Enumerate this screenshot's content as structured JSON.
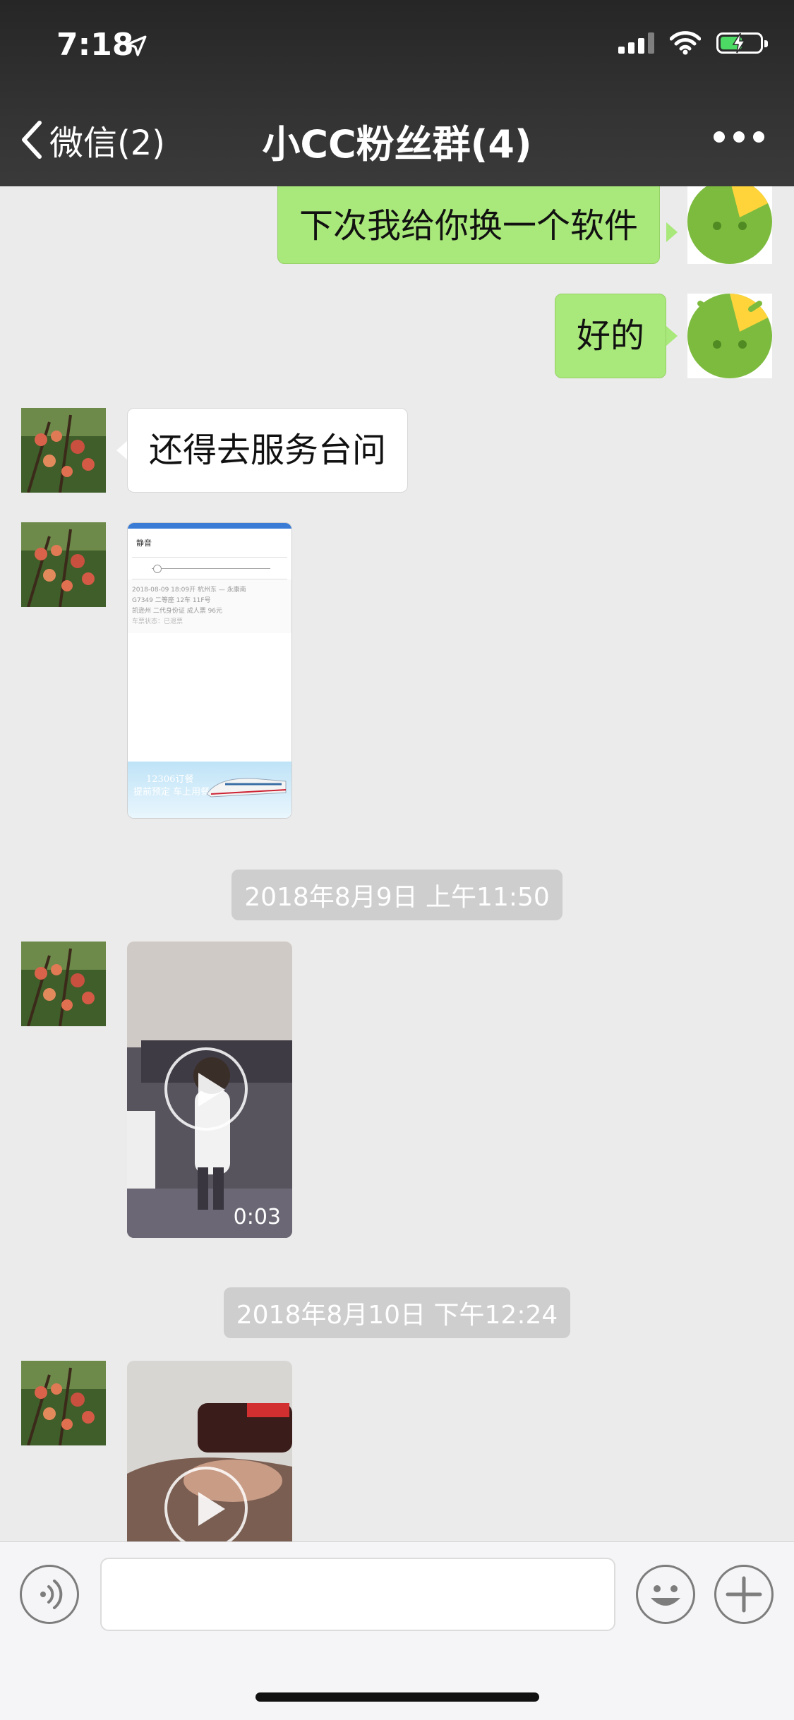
{
  "status_bar": {
    "time": "7:18"
  },
  "nav": {
    "back_label": "微信(2)",
    "title": "小CC粉丝群(4)"
  },
  "messages": {
    "m1": "下次我给你换一个软件",
    "m2": "好的",
    "m3": "还得去服务台问"
  },
  "screenshot_preview": {
    "header": "静音",
    "row1": "2018-08-09  18:09开    杭州东 — 永康南",
    "row2": "G7349        二等座      12车      11F号",
    "row3": "凯逊州       二代身份证    成人票      96元",
    "row4": "车票状态：已退票",
    "banner_line1": "12306订餐",
    "banner_line2": "提前预定 车上用餐"
  },
  "timestamps": {
    "t1": "2018年8月9日 上午11:50",
    "t2": "2018年8月10日 下午12:24"
  },
  "videos": {
    "v1_duration": "0:03"
  },
  "input": {
    "value": ""
  },
  "colors": {
    "outgoing_bubble": "#a9e87a",
    "incoming_bubble": "#ffffff",
    "chat_bg": "#ebebeb",
    "battery": "#4cd964"
  }
}
